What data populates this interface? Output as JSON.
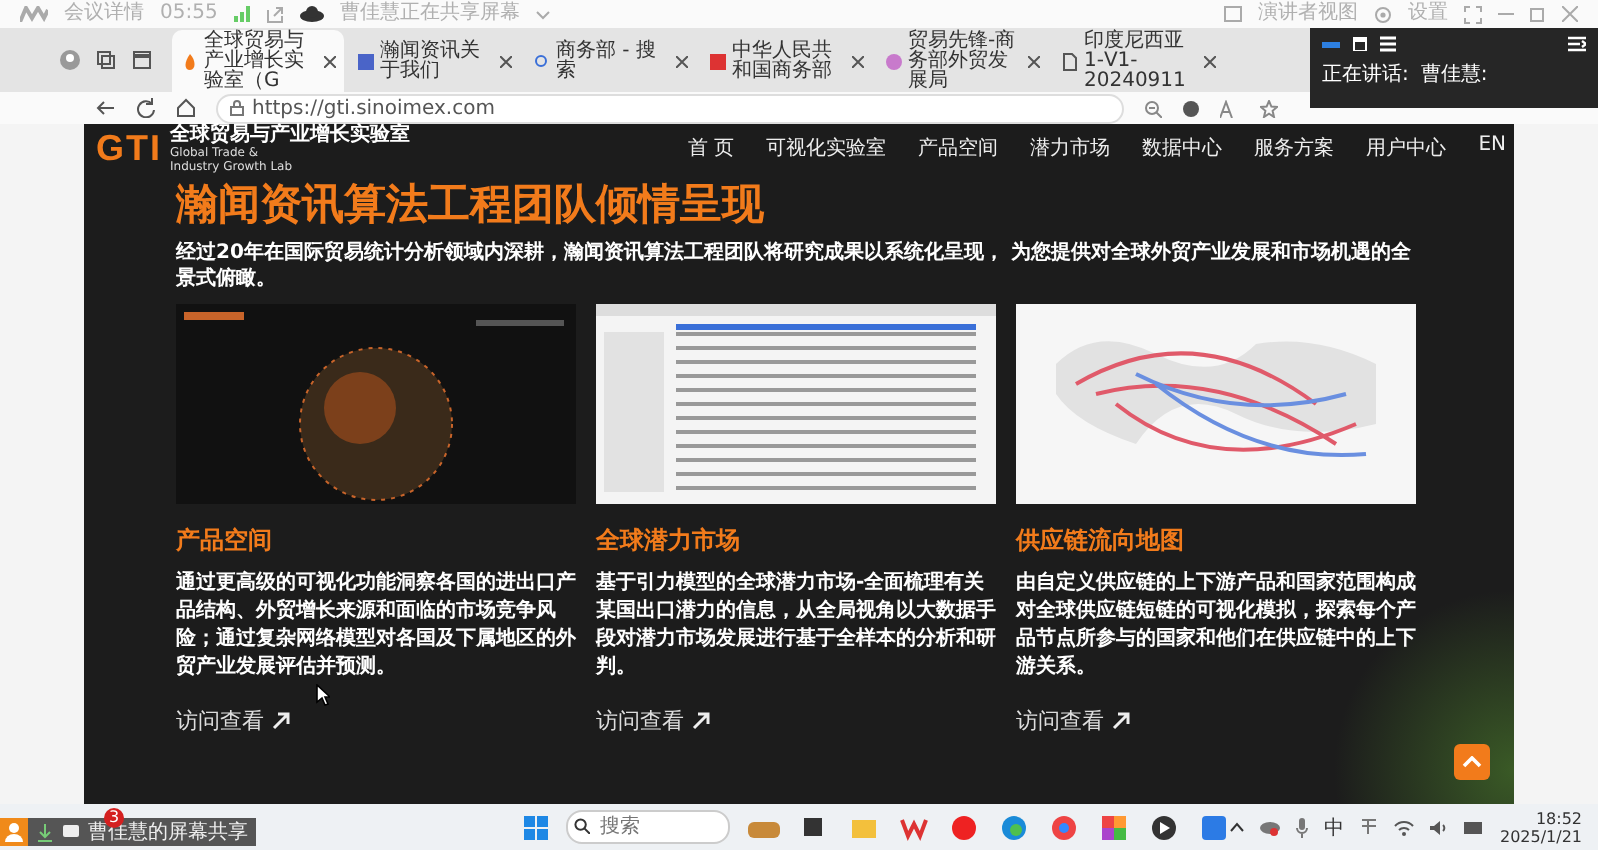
{
  "meeting_bar": {
    "label": "会议详情",
    "timer": "05:55",
    "sharing_notice": "曹佳慧正在共享屏幕",
    "presenter_view": "演讲者视图",
    "settings": "设置"
  },
  "browser": {
    "tabs": [
      {
        "title": "全球贸易与产业增长实验室（G",
        "selected": true
      },
      {
        "title": "瀚闻资讯关于我们",
        "selected": false
      },
      {
        "title": "商务部 - 搜索",
        "selected": false
      },
      {
        "title": "中华人民共和国商务部",
        "selected": false
      },
      {
        "title": "贸易先锋-商务部外贸发展局",
        "selected": false
      },
      {
        "title": "印度尼西亚1-V1-20240911",
        "selected": false
      }
    ],
    "address": "https://gti.sinoimex.com"
  },
  "speaker_panel": {
    "label": "正在讲话:",
    "speaker": "曹佳慧:"
  },
  "site": {
    "logo": {
      "mark": "GTI",
      "name_cn": "全球贸易与产业增长实验室",
      "name_en": "Global Trade & Industry Growth Lab"
    },
    "nav": [
      "首 页",
      "可视化实验室",
      "产品空间",
      "潜力市场",
      "数据中心",
      "服务方案",
      "用户中心",
      "EN"
    ],
    "heading": "瀚闻资讯算法工程团队倾情呈现",
    "intro": "经过20年在国际贸易统计分析领域内深耕，瀚闻资讯算法工程团队将研究成果以系统化呈现， 为您提供对全球外贸产业发展和市场机遇的全景式俯瞰。",
    "cards": [
      {
        "kind": "globe",
        "title": "产品空间",
        "description": "通过更高级的可视化功能洞察各国的进出口产品结构、外贸增长来源和面临的市场竞争风险；通过复杂网络模型对各国及下属地区的外贸产业发展评估并预测。",
        "link": "访问查看"
      },
      {
        "kind": "table",
        "title": "全球潜力市场",
        "description": "基于引力模型的全球潜力市场-全面梳理有关某国出口潜力的信息，从全局视角以大数据手段对潜力市场发展进行基于全样本的分析和研判。",
        "link": "访问查看"
      },
      {
        "kind": "map",
        "title": "供应链流向地图",
        "description": "由自定义供应链的上下游产品和国家范围构成对全球供应链短链的可视化模拟，探索每个产品节点所参与的国家和他们在供应链中的上下游关系。",
        "link": "访问查看"
      }
    ]
  },
  "share_bar": {
    "label": "曹佳慧的屏幕共享"
  },
  "taskbar": {
    "notification_count": "3",
    "search_placeholder": "搜索",
    "input_method": "中",
    "time": "18:52",
    "date": "2025/1/21"
  }
}
